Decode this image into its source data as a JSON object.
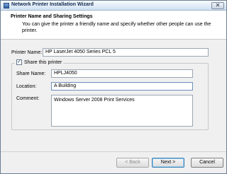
{
  "window": {
    "title": "Network Printer Installation Wizard",
    "close_glyph": "✕"
  },
  "header": {
    "title": "Printer Name and Sharing Settings",
    "description": "You can give the printer a friendly name and specify whether other people can use the printer."
  },
  "printer": {
    "label": "Printer Name:",
    "value": "HP LaserJet 4050 Series PCL 5"
  },
  "share": {
    "checkbox_label": "Share this printer",
    "checked": true,
    "check_glyph": "✓",
    "share_name_label": "Share Name:",
    "share_name_value": "HPLJ4050",
    "location_label": "Location:",
    "location_value": "A Building",
    "comment_label": "Comment:",
    "comment_value": "Windows Server 2008 Print Services"
  },
  "buttons": {
    "back": "< Back",
    "next": "Next >",
    "cancel": "Cancel"
  },
  "colors": {
    "title_gradient_top": "#f7fbff",
    "title_gradient_bottom": "#cfe0f2",
    "dialog_bg": "#f0f0f0",
    "default_button_border": "#3c7fb1"
  }
}
